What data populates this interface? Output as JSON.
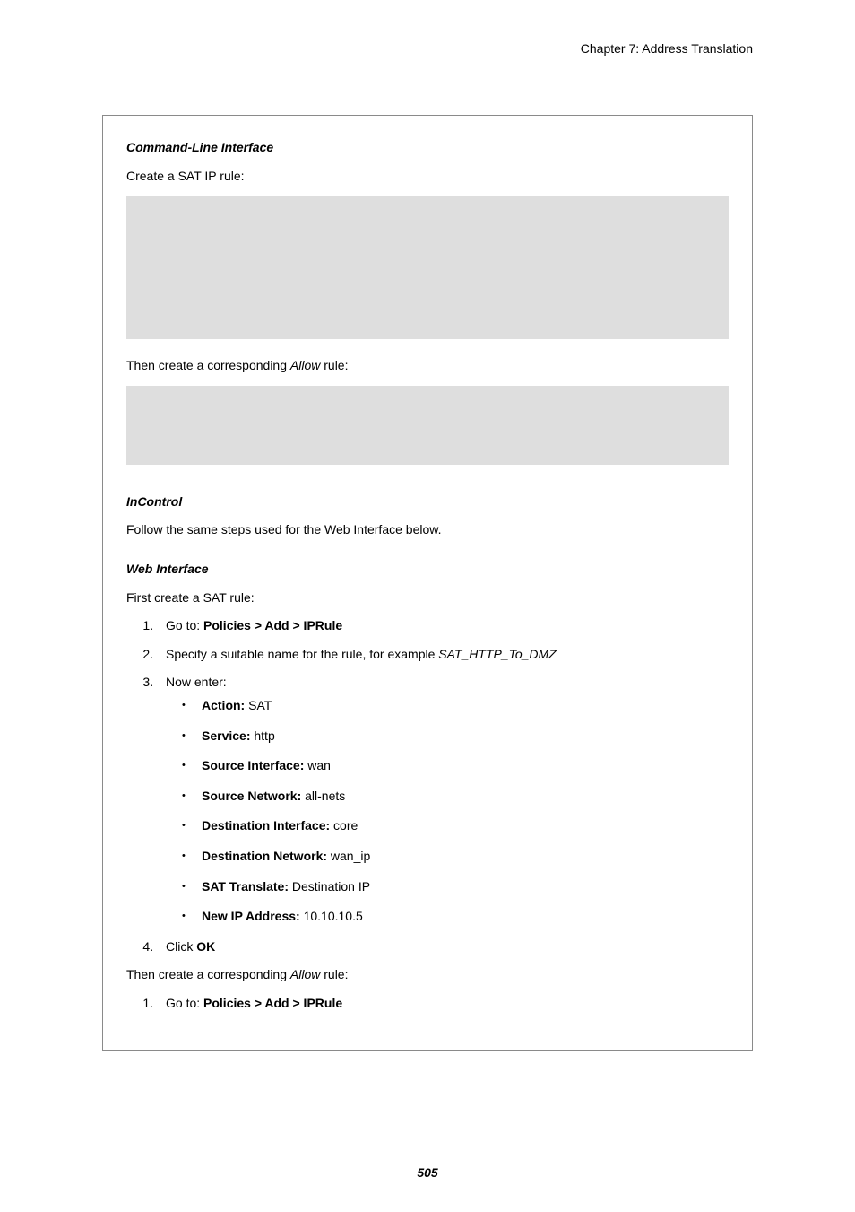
{
  "header": {
    "running": "Chapter 7: Address Translation"
  },
  "sections": {
    "cli": {
      "title": "Command-Line Interface",
      "intro": "Create a SAT IP rule:",
      "after_block": "Then create a corresponding ",
      "after_block_italic": "Allow",
      "after_block_tail": " rule:"
    },
    "incontrol": {
      "title": "InControl",
      "body": "Follow the same steps used for the Web Interface below."
    },
    "web": {
      "title": "Web Interface",
      "intro": "First create a SAT rule:",
      "steps": {
        "s1_pre": "Go to: ",
        "s1_bold": "Policies > Add > IPRule",
        "s2_pre": "Specify a suitable name for the rule, for example ",
        "s2_italic": "SAT_HTTP_To_DMZ",
        "s3": "Now enter:",
        "bullets": [
          {
            "label": "Action:",
            "value": " SAT"
          },
          {
            "label": "Service:",
            "value": " http"
          },
          {
            "label": "Source Interface:",
            "value": " wan"
          },
          {
            "label": "Source Network:",
            "value": " all-nets"
          },
          {
            "label": "Destination Interface:",
            "value": " core"
          },
          {
            "label": "Destination Network:",
            "value": " wan_ip"
          },
          {
            "label": "SAT Translate:",
            "value": " Destination IP"
          },
          {
            "label": "New IP Address:",
            "value": " 10.10.10.5"
          }
        ],
        "s4_pre": "Click ",
        "s4_bold": "OK"
      },
      "after_steps_pre": "Then create a corresponding ",
      "after_steps_italic": "Allow",
      "after_steps_tail": " rule:",
      "steps2": {
        "s1_pre": "Go to: ",
        "s1_bold": "Policies > Add > IPRule"
      }
    }
  },
  "footer": {
    "page_number": "505"
  }
}
